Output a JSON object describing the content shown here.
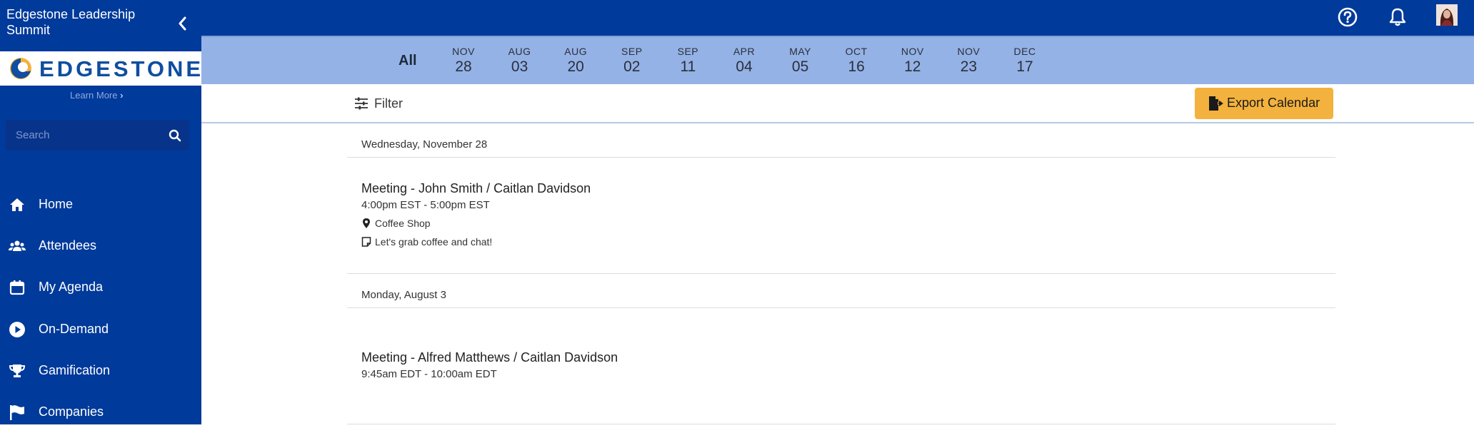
{
  "app": {
    "title": "Edgestone Leadership Summit"
  },
  "brand": {
    "logo_text": "EDGESTONE",
    "learn_more": "Learn More",
    "accent": "#003a9b",
    "datebar_bg": "#94b2e6",
    "export_bg": "#f3b23d"
  },
  "search": {
    "placeholder": "Search"
  },
  "nav": [
    {
      "label": "Home",
      "icon": "home-icon"
    },
    {
      "label": "Attendees",
      "icon": "users-icon"
    },
    {
      "label": "My Agenda",
      "icon": "calendar-icon"
    },
    {
      "label": "On-Demand",
      "icon": "play-icon"
    },
    {
      "label": "Gamification",
      "icon": "trophy-icon"
    },
    {
      "label": "Companies",
      "icon": "flag-icon"
    }
  ],
  "dates": {
    "all_label": "All",
    "items": [
      {
        "month": "NOV",
        "day": "28"
      },
      {
        "month": "AUG",
        "day": "03"
      },
      {
        "month": "AUG",
        "day": "20"
      },
      {
        "month": "SEP",
        "day": "02"
      },
      {
        "month": "SEP",
        "day": "11"
      },
      {
        "month": "APR",
        "day": "04"
      },
      {
        "month": "MAY",
        "day": "05"
      },
      {
        "month": "OCT",
        "day": "16"
      },
      {
        "month": "NOV",
        "day": "12"
      },
      {
        "month": "NOV",
        "day": "23"
      },
      {
        "month": "DEC",
        "day": "17"
      }
    ]
  },
  "toolbar": {
    "filter_label": "Filter",
    "export_label": "Export Calendar"
  },
  "days": [
    {
      "header": "Wednesday, November 28",
      "event": {
        "title": "Meeting - John Smith / Caitlan Davidson",
        "time": "4:00pm EST - 5:00pm EST",
        "location": "Coffee Shop",
        "note": "Let's grab coffee and chat!"
      }
    },
    {
      "header": "Monday, August 3",
      "event": {
        "title": "Meeting - Alfred Matthews / Caitlan Davidson",
        "time": "9:45am EDT - 10:00am EDT"
      }
    }
  ]
}
